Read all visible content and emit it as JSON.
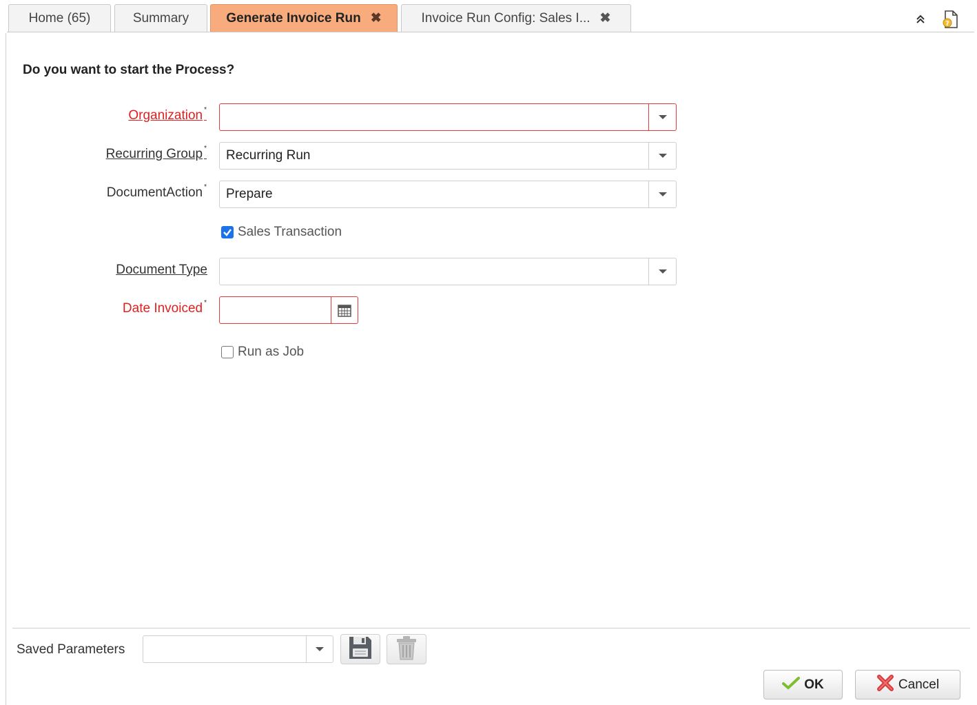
{
  "tabs": [
    {
      "label": "Home (65)"
    },
    {
      "label": "Summary"
    },
    {
      "label": "Generate Invoice Run",
      "active": true
    },
    {
      "label": "Invoice Run Config: Sales I..."
    }
  ],
  "toolbar_icons": [
    "collapse-icon",
    "help-document-icon"
  ],
  "dialog": {
    "prompt": "Do you want to start the Process?",
    "fields": {
      "organization": {
        "label": "Organization",
        "value": "",
        "required": true
      },
      "recurring_group": {
        "label": "Recurring Group",
        "value": "Recurring Run",
        "required": true
      },
      "document_action": {
        "label": "DocumentAction",
        "value": "Prepare",
        "required": true
      },
      "sales_transaction": {
        "label": "Sales Transaction",
        "checked": true
      },
      "document_type": {
        "label": "Document Type",
        "value": ""
      },
      "date_invoiced": {
        "label": "Date Invoiced",
        "value": "",
        "required": true
      },
      "run_as_job": {
        "label": "Run as Job",
        "checked": false
      }
    },
    "required_marker": "*"
  },
  "footer": {
    "saved_parameters_label": "Saved Parameters",
    "saved_parameters_value": "",
    "ok_label": "OK",
    "cancel_label": "Cancel"
  },
  "colors": {
    "active_tab": "#f8ab7d",
    "required": "#e02020",
    "checkbox": "#1a73e8"
  }
}
